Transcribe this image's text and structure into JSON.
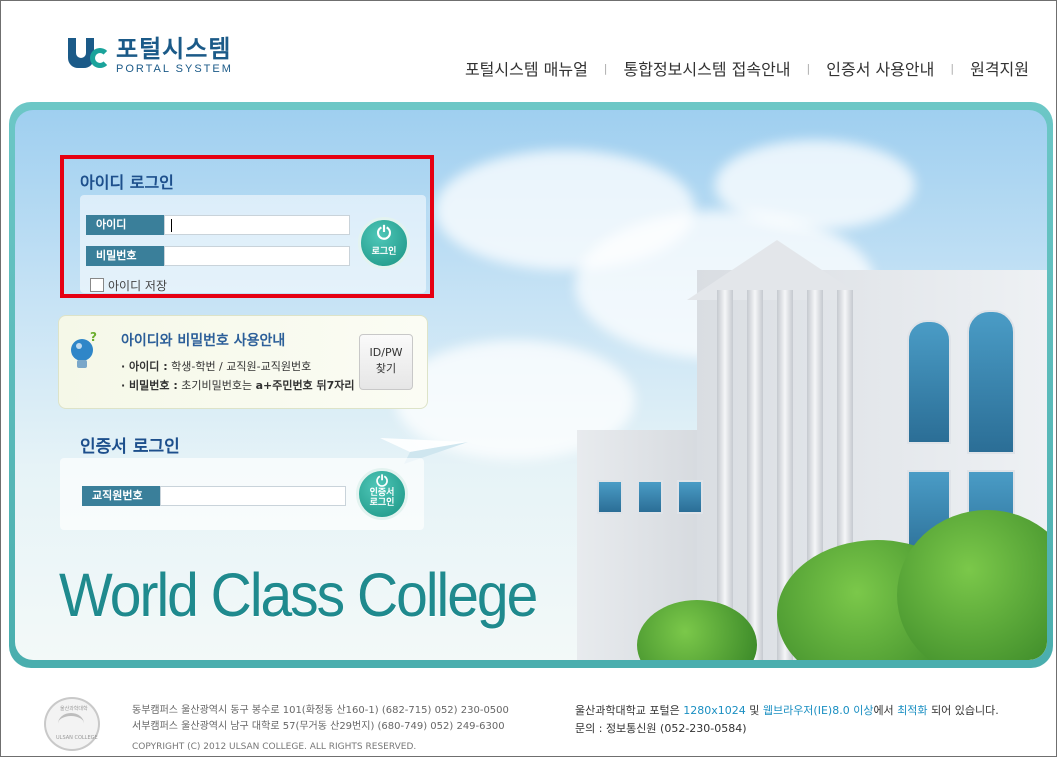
{
  "header": {
    "logo_title": "포털시스템",
    "logo_subtitle": "PORTAL SYSTEM",
    "nav": [
      "포털시스템 매뉴얼",
      "통합정보시스템 접속안내",
      "인증서 사용안내",
      "원격지원"
    ],
    "separator": "|"
  },
  "id_login": {
    "title": "아이디 로그인",
    "id_label": "아이디",
    "id_value": "",
    "pw_label": "비밀번호",
    "pw_value": "",
    "login_button": "로그인",
    "save_id_label": "아이디 저장",
    "save_id_checked": false
  },
  "guide": {
    "title": "아이디와 비밀번호 사용안내",
    "line1_label": "· 아이디 :",
    "line1_text": "학생-학번 / 교직원-교직원번호",
    "line2_label": "· 비밀번호 :",
    "line2_text": "초기비밀번호는",
    "line2_strong": "a+주민번호 뒤7자리",
    "find_line1": "ID/PW",
    "find_line2": "찾기"
  },
  "cert_login": {
    "title": "인증서 로그인",
    "staff_label": "교직원번호",
    "staff_value": "",
    "button_line1": "인증서",
    "button_line2": "로그인"
  },
  "slogan": "World Class College",
  "footer": {
    "seal_top": "울산과학대학",
    "seal_bottom": "ULSAN COLLEGE",
    "east_campus": "동부캠퍼스  울산광역시 동구 봉수로 101(화정동 산160-1) (682-715)  052) 230-0500",
    "west_campus": "서부캠퍼스  울산광역시 남구 대학로 57(무거동 산29번지) (680-749)  052) 249-6300",
    "copyright": "COPYRIGHT (C) 2012 ULSAN COLLEGE. ALL RIGHTS RESERVED.",
    "notice_pre": "울산과학대학교 포털은",
    "notice_res": "1280x1024",
    "notice_mid": "및",
    "notice_browser": "웹브라우저(IE)8.0 이상",
    "notice_mid2": "에서",
    "notice_opt": "최적화",
    "notice_post": "되어 있습니다.",
    "contact": "문의 : 정보통신원 (052-230-0584)"
  },
  "colors": {
    "accent": "#1a9383",
    "brand": "#1b5a88",
    "highlight": "#e60012"
  }
}
